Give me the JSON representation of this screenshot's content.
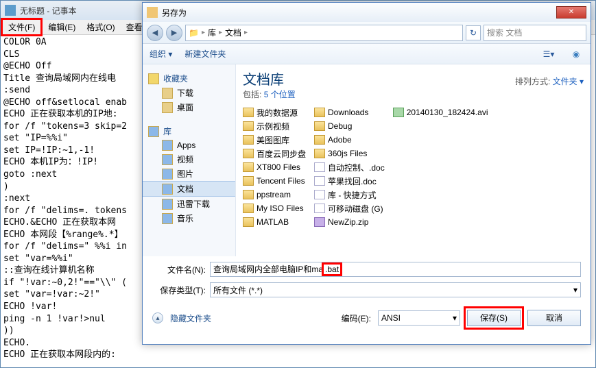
{
  "notepad": {
    "title": "无标题 - 记事本",
    "menu": {
      "file": "文件(F)",
      "edit": "编辑(E)",
      "format": "格式(O)",
      "view": "查看"
    },
    "content": "COLOR 0A\nCLS\n@ECHO Off\nTitle 查询局域网内在线电\n:send\n@ECHO off&setlocal enab\nECHO 正在获取本机的IP地:\nfor /f \"tokens=3 skip=2\nset \"IP=%%i\"\nset IP=!IP:~1,-1!\nECHO 本机IP为：!IP!\ngoto :next\n)\n:next\nfor /f \"delims=. tokens\nECHO.&ECHO 正在获取本网\nECHO 本网段【%range%.*】\nfor /f \"delims=\" %%i in\nset \"var=%%i\"\n::查询在线计算机名称\nif \"!var:~0,2!\"==\"\\\\\" (\nset \"var=!var:~2!\"\nECHO !var!\nping -n 1 !var!>nul\n))\nECHO.\nECHO 正在获取本网段内的:"
  },
  "saveas": {
    "title": "另存为",
    "breadcrumb": {
      "seg1": "库",
      "seg2": "文档"
    },
    "search_placeholder": "搜索 文档",
    "toolbar": {
      "organize": "组织 ▾",
      "newfolder": "新建文件夹"
    },
    "sidebar": {
      "fav_head": "收藏夹",
      "fav_items": [
        "下载",
        "桌面"
      ],
      "lib_head": "库",
      "lib_items": [
        "Apps",
        "视频",
        "图片",
        "文档",
        "迅雷下载",
        "音乐"
      ]
    },
    "main": {
      "title": "文档库",
      "include_lbl": "包括:",
      "include_link": "5 个位置",
      "sort_lbl": "排列方式:",
      "sort_link": "文件夹 ▾"
    },
    "files_col1": [
      "我的数据源",
      "示例视频",
      "美图图库",
      "百度云同步盘",
      "XT800 Files",
      "Tencent Files",
      "ppstream",
      "My ISO Files",
      "MATLAB"
    ],
    "files_col2": [
      {
        "ico": "folder",
        "name": "Downloads"
      },
      {
        "ico": "folder",
        "name": "Debug"
      },
      {
        "ico": "folder",
        "name": "Adobe"
      },
      {
        "ico": "folder",
        "name": "360js Files"
      },
      {
        "ico": "file",
        "name": "自动控制、.doc"
      },
      {
        "ico": "file",
        "name": "苹果找回.doc"
      },
      {
        "ico": "file",
        "name": "库 - 快捷方式"
      },
      {
        "ico": "file",
        "name": "可移动磁盘 (G)"
      },
      {
        "ico": "zip",
        "name": "NewZip.zip"
      }
    ],
    "files_col3": [
      {
        "ico": "avi",
        "name": "20140130_182424.avi"
      }
    ],
    "filename_lbl": "文件名(N):",
    "filename_val_pre": "查询局域网内全部电脑IP和ma",
    "filename_val_hl": ".bat",
    "filetype_lbl": "保存类型(T):",
    "filetype_val": "所有文件 (*.*)",
    "hide_folders": "隐藏文件夹",
    "encoding_lbl": "编码(E):",
    "encoding_val": "ANSI",
    "save_btn": "保存(S)",
    "cancel_btn": "取消"
  }
}
